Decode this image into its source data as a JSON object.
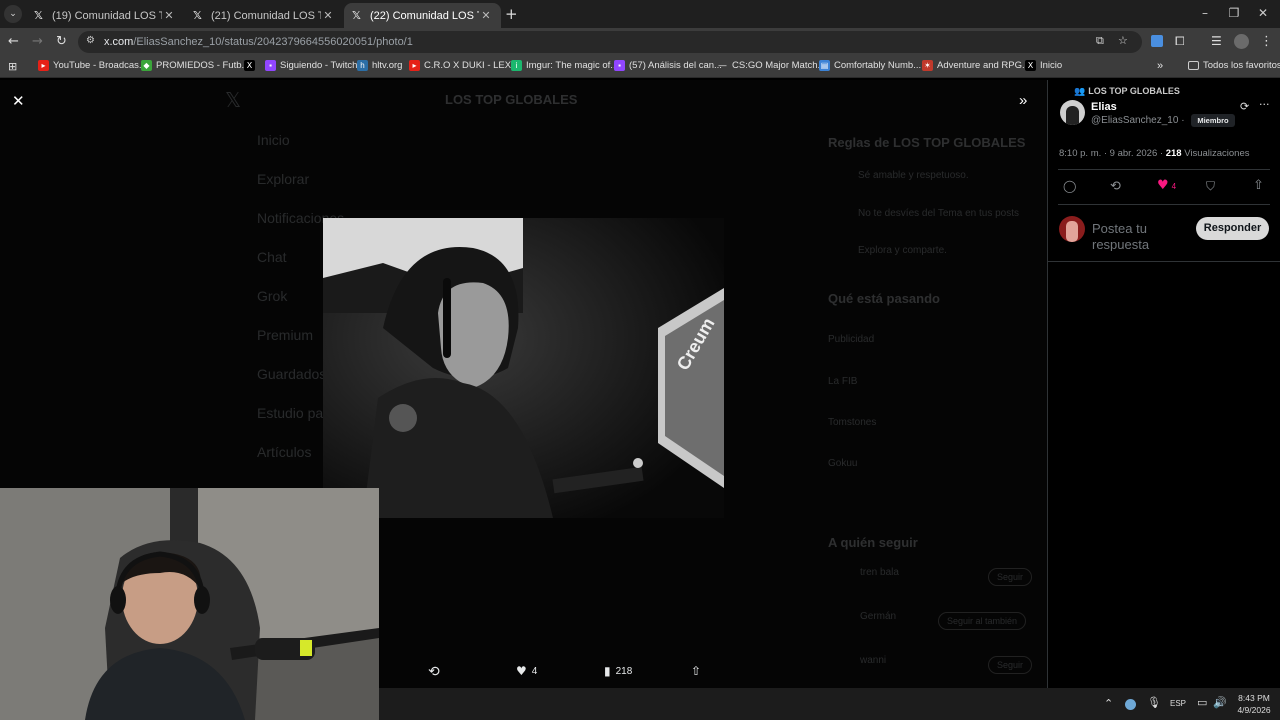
{
  "tabs": [
    {
      "title": "(19) Comunidad LOS TOP GLOB"
    },
    {
      "title": "(21) Comunidad LOS TOP GLOB"
    },
    {
      "title": "(22) Comunidad LOS TOP GLOB"
    }
  ],
  "address": {
    "domain": "x.com",
    "path": "/EliasSanchez_10/status/2042379664556020051/photo/1"
  },
  "bookmarks": [
    {
      "label": "YouTube - Broadcas..."
    },
    {
      "label": "PROMIEDOS - Futb..."
    },
    {
      "label": ""
    },
    {
      "label": "Siguiendo - Twitch"
    },
    {
      "label": "hltv.org"
    },
    {
      "label": "C.R.O X DUKI - LEX..."
    },
    {
      "label": "Imgur: The magic of..."
    },
    {
      "label": "(57) Análisis del can..."
    },
    {
      "label": "CS:GO Major Match..."
    },
    {
      "label": "Comfortably Numb..."
    },
    {
      "label": "Adventure and RPG..."
    },
    {
      "label": "Inicio"
    }
  ],
  "bookmarks_folder": "Todos los favoritos",
  "background": {
    "community_title": "LOS TOP GLOBALES",
    "nav": [
      "Inicio",
      "Explorar",
      "Notificaciones",
      "Chat",
      "Grok",
      "Premium",
      "Guardados",
      "Estudio para",
      "Artículos"
    ],
    "rules_title": "Reglas de LOS TOP GLOBALES",
    "rules": [
      "Sé amable y respetuoso.",
      "No te desvíes del Tema en tus posts",
      "Explora y comparte."
    ],
    "trending_title": "Qué está pasando",
    "trends": [
      "Publicidad",
      "La FIB",
      "Tomstones",
      "Gokuu"
    ],
    "follow_title": "A quién seguir",
    "follow": [
      {
        "name": "tren bala",
        "btn": "Seguir"
      },
      {
        "name": "Germán",
        "btn": "Seguir al también"
      },
      {
        "name": "wanni",
        "btn": "Seguir"
      }
    ]
  },
  "photo_text": "Creum",
  "viewer_bar": {
    "likes": "4",
    "views": "218"
  },
  "panel": {
    "community": "LOS TOP GLOBALES",
    "name": "Elias",
    "handle": "@EliasSanchez_10",
    "sep": "·",
    "badge": "Miembro",
    "time": "8:10 p. m. · 9 abr. 2026 ·",
    "views": "218",
    "views_label": "Visualizaciones",
    "likes": "4",
    "reply_placeholder": "Postea tu respuesta",
    "reply_button": "Responder"
  },
  "taskbar": {
    "lang": "ESP",
    "time": "8:43 PM",
    "date": "4/9/2026"
  },
  "colors": {
    "like": "#f91880",
    "button_bg": "#d9d9d9",
    "accent": "#1d9bf0"
  }
}
